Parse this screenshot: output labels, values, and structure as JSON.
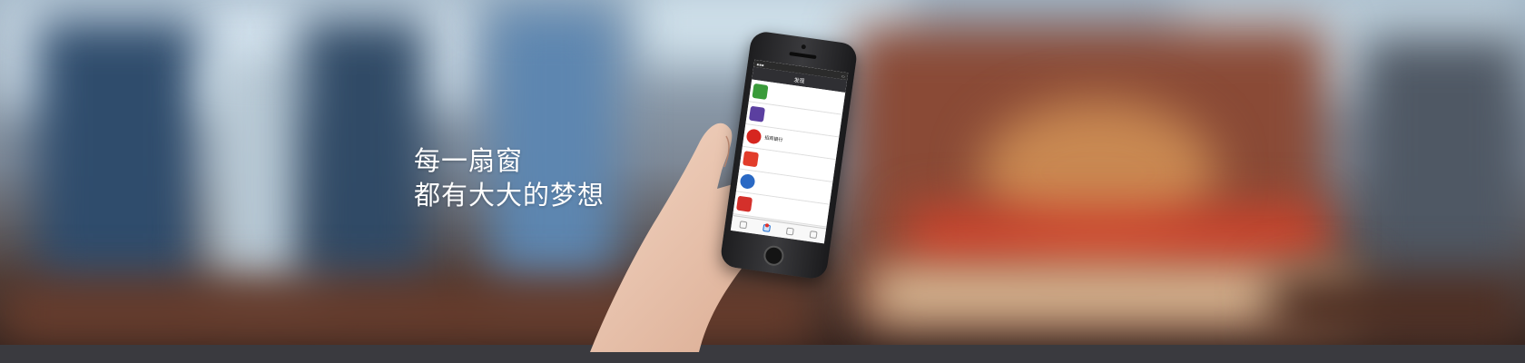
{
  "slogan": {
    "line1": "每一扇窗",
    "line2": "都有大大的梦想"
  },
  "phone_screen": {
    "status_time": "",
    "nav_title": "发现",
    "rows": [
      {
        "title": "",
        "subtitle": "",
        "icon": "checkbox-icon",
        "color": "#3a9b3a"
      },
      {
        "title": "",
        "subtitle": "",
        "icon": "bag-icon",
        "color": "#5b3fa0"
      },
      {
        "title": "招商银行",
        "subtitle": "",
        "icon": "bank-icon",
        "color": "#d6261f"
      },
      {
        "title": "",
        "subtitle": "",
        "icon": "app-icon",
        "color": "#e23c2a"
      },
      {
        "title": "",
        "subtitle": "",
        "icon": "telecom-icon",
        "color": "#2a69c4"
      },
      {
        "title": "",
        "subtitle": "",
        "icon": "airline-icon",
        "color": "#d4302b"
      }
    ],
    "tabs": [
      {
        "label": "",
        "icon": "chat-icon"
      },
      {
        "label": "",
        "icon": "discover-icon",
        "active": true
      },
      {
        "label": "",
        "icon": "contacts-icon"
      },
      {
        "label": "",
        "icon": "me-icon"
      }
    ]
  }
}
